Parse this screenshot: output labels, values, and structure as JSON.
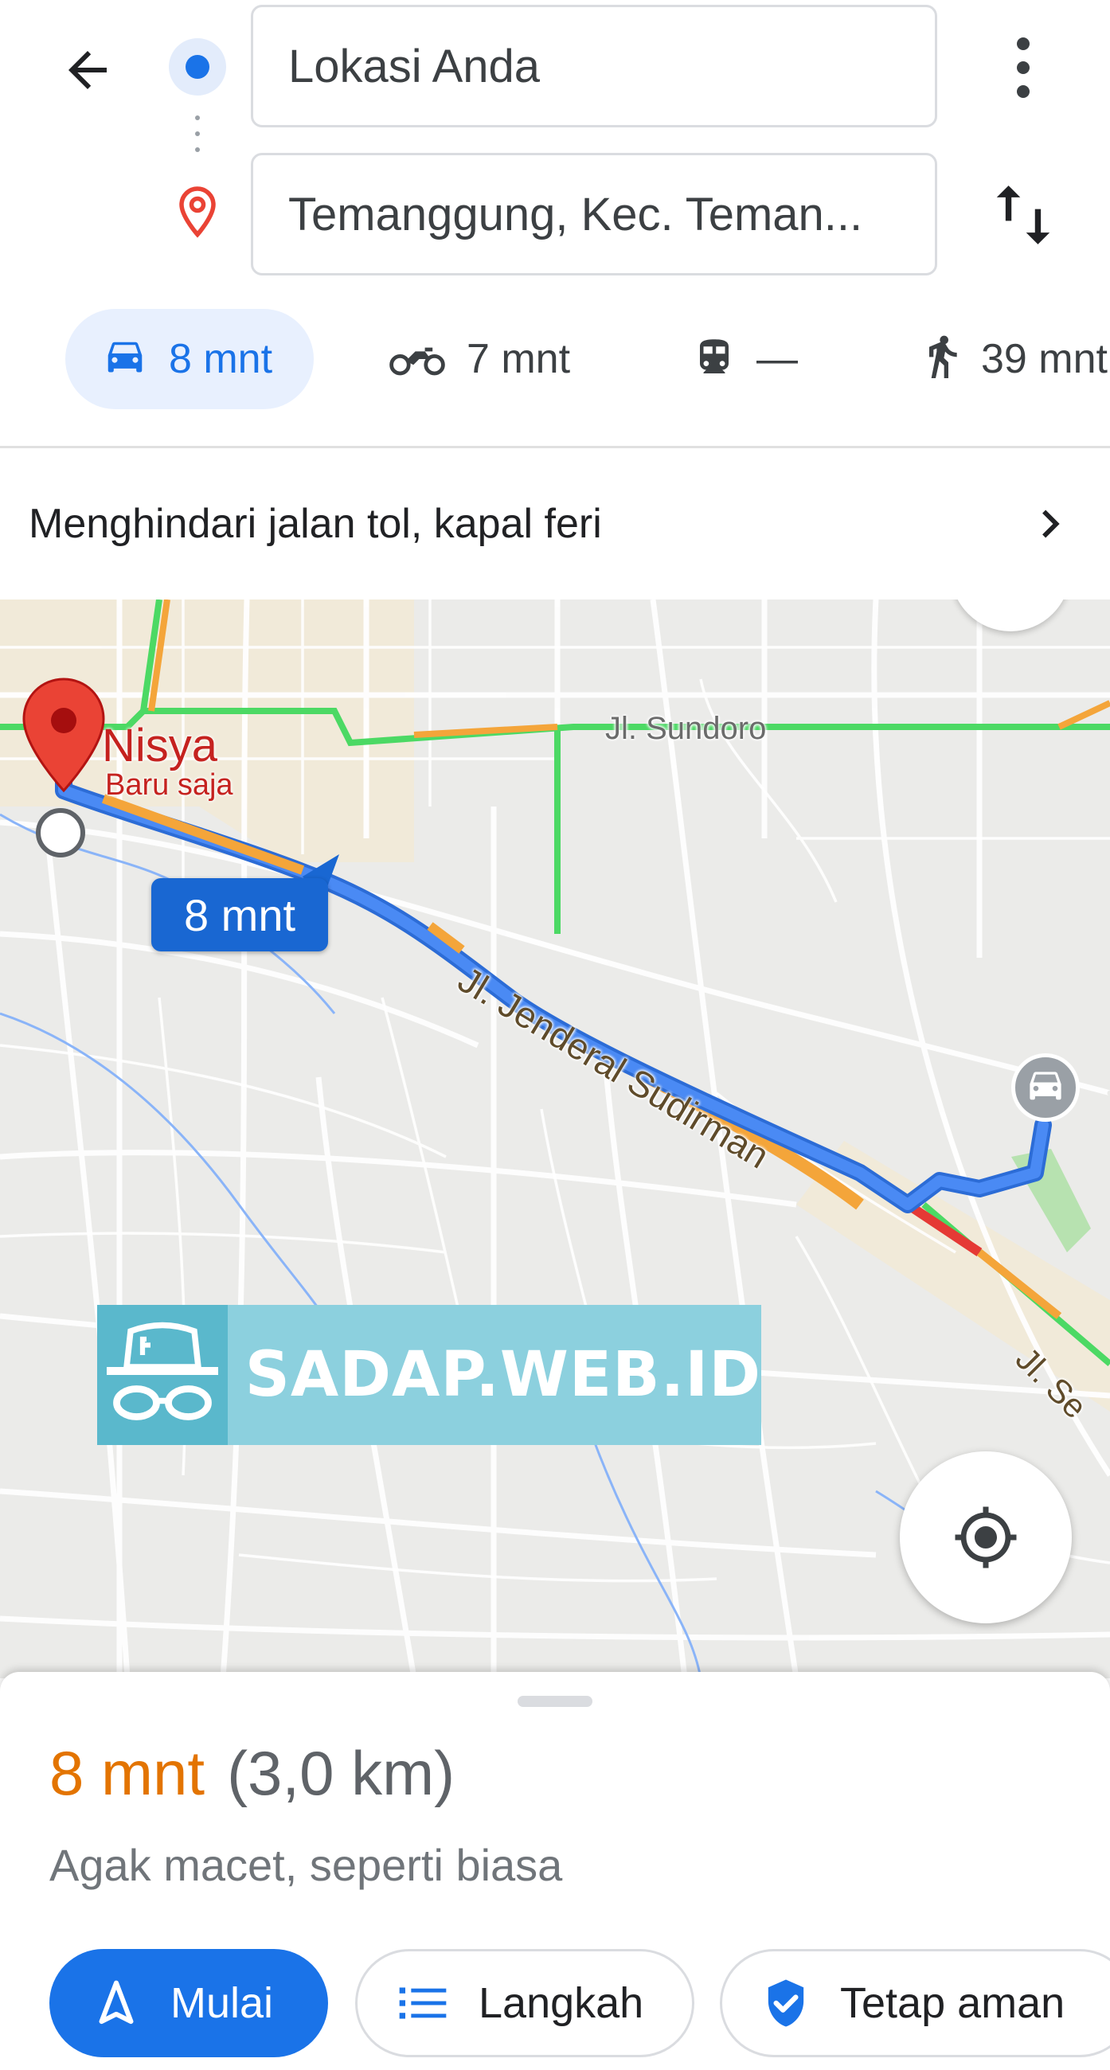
{
  "header": {
    "origin_value": "Lokasi Anda",
    "destination_value": "Temanggung, Kec. Teman..."
  },
  "modes": [
    {
      "name": "car",
      "label": "8 mnt",
      "active": true
    },
    {
      "name": "motorcycle",
      "label": "7 mnt",
      "active": false
    },
    {
      "name": "transit",
      "label": "—",
      "active": false
    },
    {
      "name": "walk",
      "label": "39 mnt",
      "active": false
    }
  ],
  "options": {
    "label": "Menghindari jalan tol, kapal feri"
  },
  "map": {
    "eta_bubble": "8 mnt",
    "pin_name": "Nisya",
    "pin_subtitle": "Baru saja",
    "road_labels": {
      "sundoro": "Jl. Sundoro",
      "sudirman": "Jl. Jenderal Sudirman",
      "se": "Jl. Se"
    },
    "watermark": "SADAP.WEB.ID",
    "colors": {
      "route": "#4285f4",
      "traffic_green": "#4cd964",
      "traffic_orange": "#f4a53a",
      "traffic_red": "#e53935"
    }
  },
  "sheet": {
    "time": "8 mnt",
    "distance": "(3,0 km)",
    "traffic": "Agak macet, seperti biasa",
    "start_label": "Mulai",
    "steps_label": "Langkah",
    "safe_label": "Tetap aman"
  },
  "colors": {
    "accent": "#1a73e8",
    "time_orange": "#e37400",
    "pin_red": "#ea4335"
  }
}
